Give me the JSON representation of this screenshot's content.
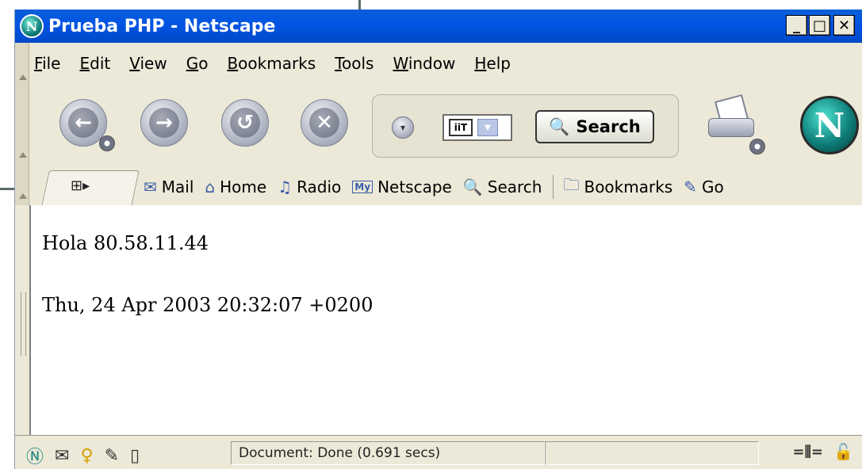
{
  "window": {
    "title": "Prueba PHP - Netscape",
    "minimize": "_",
    "maximize": "□",
    "close": "✕"
  },
  "menubar": {
    "items": [
      {
        "label": "File",
        "key": "F",
        "rest": "ile"
      },
      {
        "label": "Edit",
        "key": "E",
        "rest": "dit"
      },
      {
        "label": "View",
        "key": "V",
        "rest": "iew"
      },
      {
        "label": "Go",
        "key": "G",
        "rest": "o"
      },
      {
        "label": "Bookmarks",
        "key": "B",
        "rest": "ookmarks"
      },
      {
        "label": "Tools",
        "key": "T",
        "rest": "ools"
      },
      {
        "label": "Window",
        "key": "W",
        "rest": "indow"
      },
      {
        "label": "Help",
        "key": "H",
        "rest": "elp"
      }
    ]
  },
  "navbar": {
    "back_glyph": "←",
    "forward_glyph": "→",
    "reload_glyph": "↺",
    "stop_glyph": "✕",
    "site_icon_label": "iiT",
    "search_label": "Search",
    "throbber_letter": "N"
  },
  "personal_toolbar": {
    "items": [
      {
        "icon": "✉",
        "label": "Mail"
      },
      {
        "icon": "⌂",
        "label": "Home"
      },
      {
        "icon": "♫",
        "label": "Radio"
      },
      {
        "icon": "My",
        "label": "Netscape"
      },
      {
        "icon": "🔍",
        "label": "Search"
      }
    ],
    "bookmarks_label": "Bookmarks",
    "overflow_label": "Go"
  },
  "content": {
    "line1": "Hola 80.58.11.44",
    "line2": "Thu, 24 Apr 2003 20:32:07 +0200"
  },
  "status": {
    "text": "Document: Done (0.691 secs)"
  },
  "colors": {
    "title_bar": "#0054e3",
    "chrome": "#ece9d8",
    "page": "#ffffff"
  }
}
